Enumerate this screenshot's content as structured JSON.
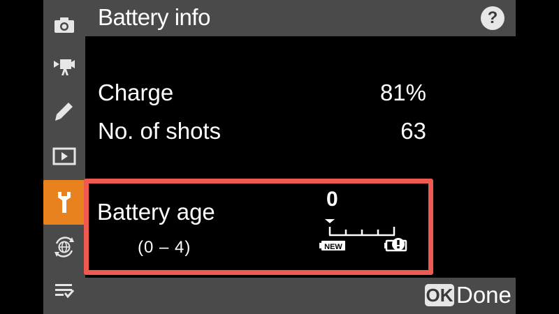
{
  "header": {
    "title": "Battery info",
    "help_label": "?"
  },
  "sidebar": {
    "tabs": [
      {
        "icon": "camera-icon",
        "active": false
      },
      {
        "icon": "movie-camera-icon",
        "active": false
      },
      {
        "icon": "pencil-icon",
        "active": false
      },
      {
        "icon": "playback-icon",
        "active": false
      },
      {
        "icon": "wrench-icon",
        "active": true
      },
      {
        "icon": "network-icon",
        "active": false
      },
      {
        "icon": "my-menu-icon",
        "active": false
      }
    ]
  },
  "info": {
    "charge_label": "Charge",
    "charge_value": "81%",
    "shots_label": "No. of shots",
    "shots_value": "63"
  },
  "battery_age": {
    "label": "Battery age",
    "range": "(0 – 4)",
    "value": "0",
    "level": 0,
    "max_level": 4,
    "new_label": "NEW",
    "warning_icon": "battery-warning-icon"
  },
  "footer": {
    "ok_label": "OK",
    "done_label": "Done"
  },
  "colors": {
    "panel": "#4a4a4a",
    "active_tab": "#e8821e",
    "highlight_border": "#ef5a50",
    "background": "#000000"
  }
}
